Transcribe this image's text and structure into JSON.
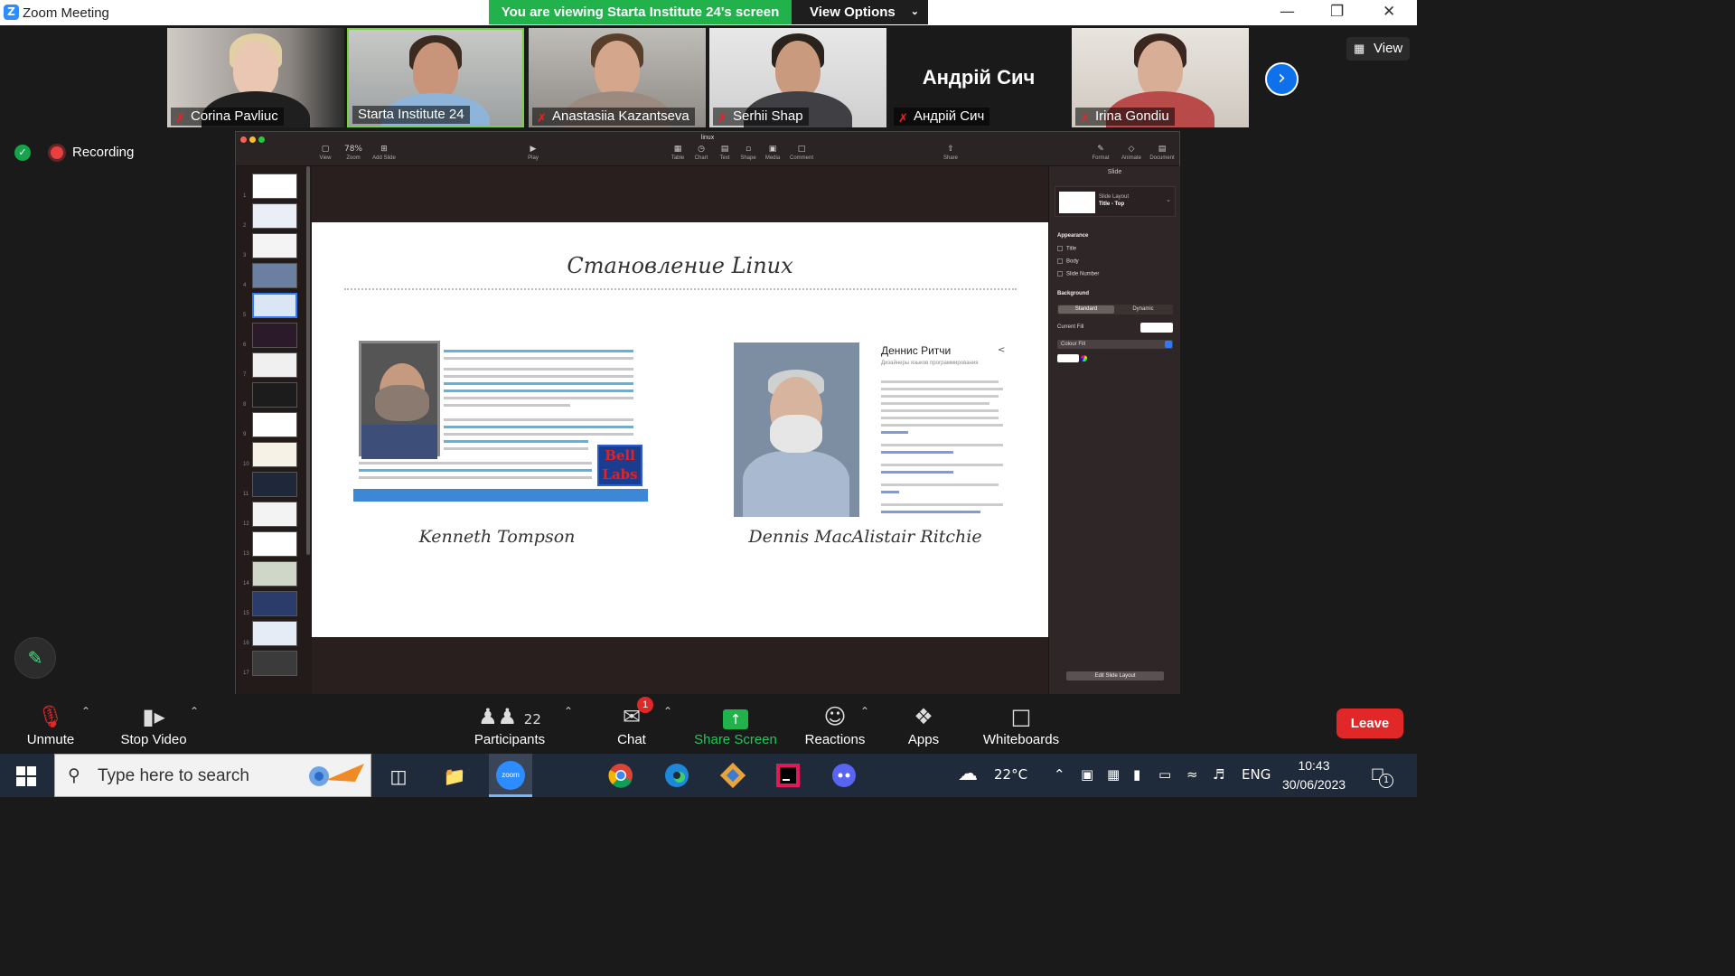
{
  "window": {
    "title": "Zoom Meeting",
    "viewing_banner": "You are viewing Starta Institute 24's screen",
    "view_options": "View Options",
    "view_button": "View"
  },
  "participants_strip": [
    {
      "name": "Corina Pavliuc",
      "muted": true
    },
    {
      "name": "Starta Institute 24",
      "muted": false,
      "active": true
    },
    {
      "name": "Anastasiia Kazantseva",
      "muted": true
    },
    {
      "name": "Serhii Shap",
      "muted": true
    },
    {
      "name": "Андрій Сич",
      "muted": true,
      "big_name": "Андрій Сич"
    },
    {
      "name": "Irina Gondiu",
      "muted": true
    }
  ],
  "recording": {
    "label": "Recording"
  },
  "keynote": {
    "filename": "linux",
    "toolbar": [
      {
        "label": "View",
        "icon": "sidebar-icon"
      },
      {
        "label": "Zoom",
        "icon": "78%"
      },
      {
        "label": "Add Slide",
        "icon": "plus-icon"
      },
      {
        "label": "Play",
        "icon": "play-icon"
      },
      {
        "label": "Table",
        "icon": "table-icon"
      },
      {
        "label": "Chart",
        "icon": "chart-icon"
      },
      {
        "label": "Text",
        "icon": "text-icon"
      },
      {
        "label": "Shape",
        "icon": "shape-icon"
      },
      {
        "label": "Media",
        "icon": "media-icon"
      },
      {
        "label": "Comment",
        "icon": "comment-icon"
      },
      {
        "label": "Share",
        "icon": "share-icon"
      },
      {
        "label": "Format",
        "icon": "brush-icon"
      },
      {
        "label": "Animate",
        "icon": "animate-icon"
      },
      {
        "label": "Document",
        "icon": "document-icon"
      }
    ],
    "slide_numbers": [
      "1",
      "2",
      "3",
      "4",
      "5",
      "6",
      "7",
      "8",
      "9",
      "10",
      "11",
      "12",
      "13",
      "14",
      "15",
      "16",
      "17"
    ],
    "selected_slide": 5,
    "slide": {
      "title": "Становление Linux",
      "caption_left": "Kenneth Tompson",
      "caption_right": "Dennis MacAlistair Ritchie",
      "dennis_heading": "Деннис Ритчи",
      "dennis_sub": "Дизайнеры языков программирования",
      "bell_logo_top": "Bell",
      "bell_logo_bottom": "Labs"
    },
    "inspector": {
      "header": "Slide",
      "layout_label": "Slide Layout",
      "layout_value": "Title - Top",
      "appearance": "Appearance",
      "options": [
        "Title",
        "Body",
        "Slide Number"
      ],
      "background": "Background",
      "seg_on": "Standard",
      "seg_off": "Dynamic",
      "current_fill": "Current Fill",
      "fill_type": "Colour Fill",
      "edit_layout": "Edit Slide Layout"
    }
  },
  "toolbar": {
    "unmute": "Unmute",
    "stop_video": "Stop Video",
    "participants": "Participants",
    "participants_count": "22",
    "chat": "Chat",
    "chat_badge": "1",
    "share_screen": "Share Screen",
    "reactions": "Reactions",
    "apps": "Apps",
    "whiteboards": "Whiteboards",
    "leave": "Leave"
  },
  "taskbar": {
    "search_placeholder": "Type here to search",
    "weather": "22°C",
    "language": "ENG",
    "time": "10:43",
    "date": "30/06/2023",
    "notifications": "1",
    "zoom_app_label": "zoom"
  },
  "colors": {
    "zoom_green": "#22b24c",
    "zoom_blue": "#2d8cff",
    "leave_red": "#e02828"
  }
}
